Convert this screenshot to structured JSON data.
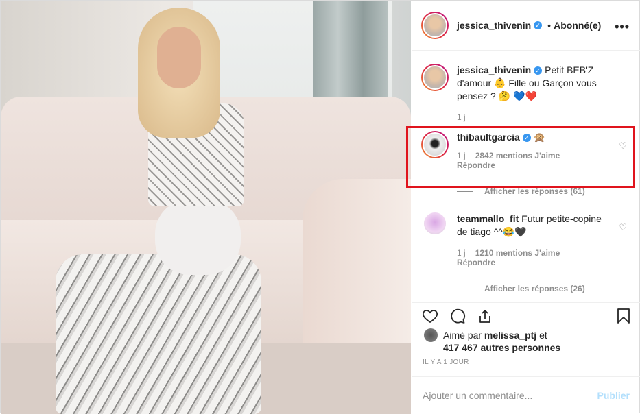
{
  "header": {
    "username": "jessica_thivenin",
    "separator": "•",
    "follow_label": "Abonné(e)",
    "more": "•••"
  },
  "caption": {
    "username": "jessica_thivenin",
    "text": "Petit BEB'Z d'amour 👶 Fille ou Garçon vous pensez ? 🤔 💙❤️",
    "time": "1 j"
  },
  "comments": [
    {
      "username": "thibaultgarcia",
      "text": "🙊",
      "time": "1 j",
      "likes": "2842 mentions J'aime",
      "reply": "Répondre",
      "view_replies": "Afficher les réponses (61)"
    },
    {
      "username": "teammallo_fit",
      "text": "Futur petite-copine de tiago ^^😂🖤",
      "time": "1 j",
      "likes": "1210 mentions J'aime",
      "reply": "Répondre",
      "view_replies": "Afficher les réponses (26)"
    }
  ],
  "likes": {
    "prefix": "Aimé par",
    "user": "melissa_ptj",
    "conj": "et",
    "count": "417 467 autres personnes"
  },
  "timestamp": "IL Y A 1 JOUR",
  "add_comment": {
    "placeholder": "Ajouter un commentaire...",
    "publish": "Publier"
  },
  "icons": {
    "like": "heart-icon",
    "comment": "comment-icon",
    "share": "share-icon",
    "save": "bookmark-icon"
  },
  "colors": {
    "highlight": "#e0141d",
    "verified": "#3897f0",
    "publish_disabled": "#b2dffc"
  }
}
